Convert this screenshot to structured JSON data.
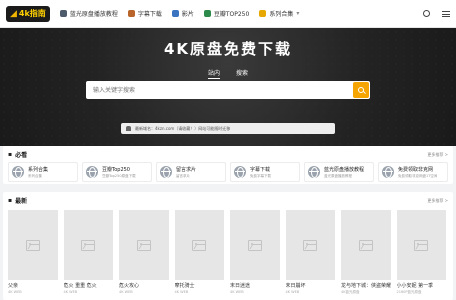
{
  "header": {
    "logo_mark": "◢",
    "logo_text": "4k指南",
    "nav": [
      {
        "label": "蓝光原盘播放教程",
        "icon": "book-icon",
        "color": "#4d5a6a"
      },
      {
        "label": "字幕下载",
        "icon": "tools-icon",
        "color": "#b8642a"
      },
      {
        "label": "影片",
        "icon": "film-icon",
        "color": "#3a74c1"
      },
      {
        "label": "豆瓣TOP250",
        "icon": "list-icon",
        "color": "#2c8a4a"
      },
      {
        "label": "系列合集",
        "icon": "bulb-icon",
        "color": "#e6a800"
      }
    ]
  },
  "hero": {
    "title": "4K原盘免费下载",
    "tabs": [
      "站内",
      "搜索"
    ],
    "search_placeholder": "输入关键字搜索",
    "notice": "最新域名：4kzn.com（请收藏！）网站可能随时迁移"
  },
  "must": {
    "title": "必看",
    "more": "更多推荐 >",
    "items": [
      {
        "name": "系列合集",
        "desc": "系列合集"
      },
      {
        "name": "豆瓣Top250",
        "desc": "豆瓣Top250原盘下载"
      },
      {
        "name": "留言求片",
        "desc": "留言求片"
      },
      {
        "name": "字幕下载",
        "desc": "免费字幕下载"
      },
      {
        "name": "蓝光原盘播放教程",
        "desc": "蓝光原盘播放教程"
      },
      {
        "name": "免费领取非克网",
        "desc": "免费领取非克网盘1T空间"
      }
    ]
  },
  "latest": {
    "title": "最新",
    "more": "更多推荐 >",
    "items": [
      {
        "title": "父亲",
        "meta": "4K WEB"
      },
      {
        "title": "危火 重重 危火",
        "meta": "4K WEB"
      },
      {
        "title": "危火攻心",
        "meta": "4K WEB"
      },
      {
        "title": "摩托骑士",
        "meta": "4K WEB"
      },
      {
        "title": "末日迷途",
        "meta": "4K WEB"
      },
      {
        "title": "末日崩坏",
        "meta": "4K WEB"
      },
      {
        "title": "龙与地下城：侠盗荣耀",
        "meta": "4K蓝光原盘"
      },
      {
        "title": "小小安妮 第一季",
        "meta": "2160P蓝光原盘"
      }
    ]
  }
}
